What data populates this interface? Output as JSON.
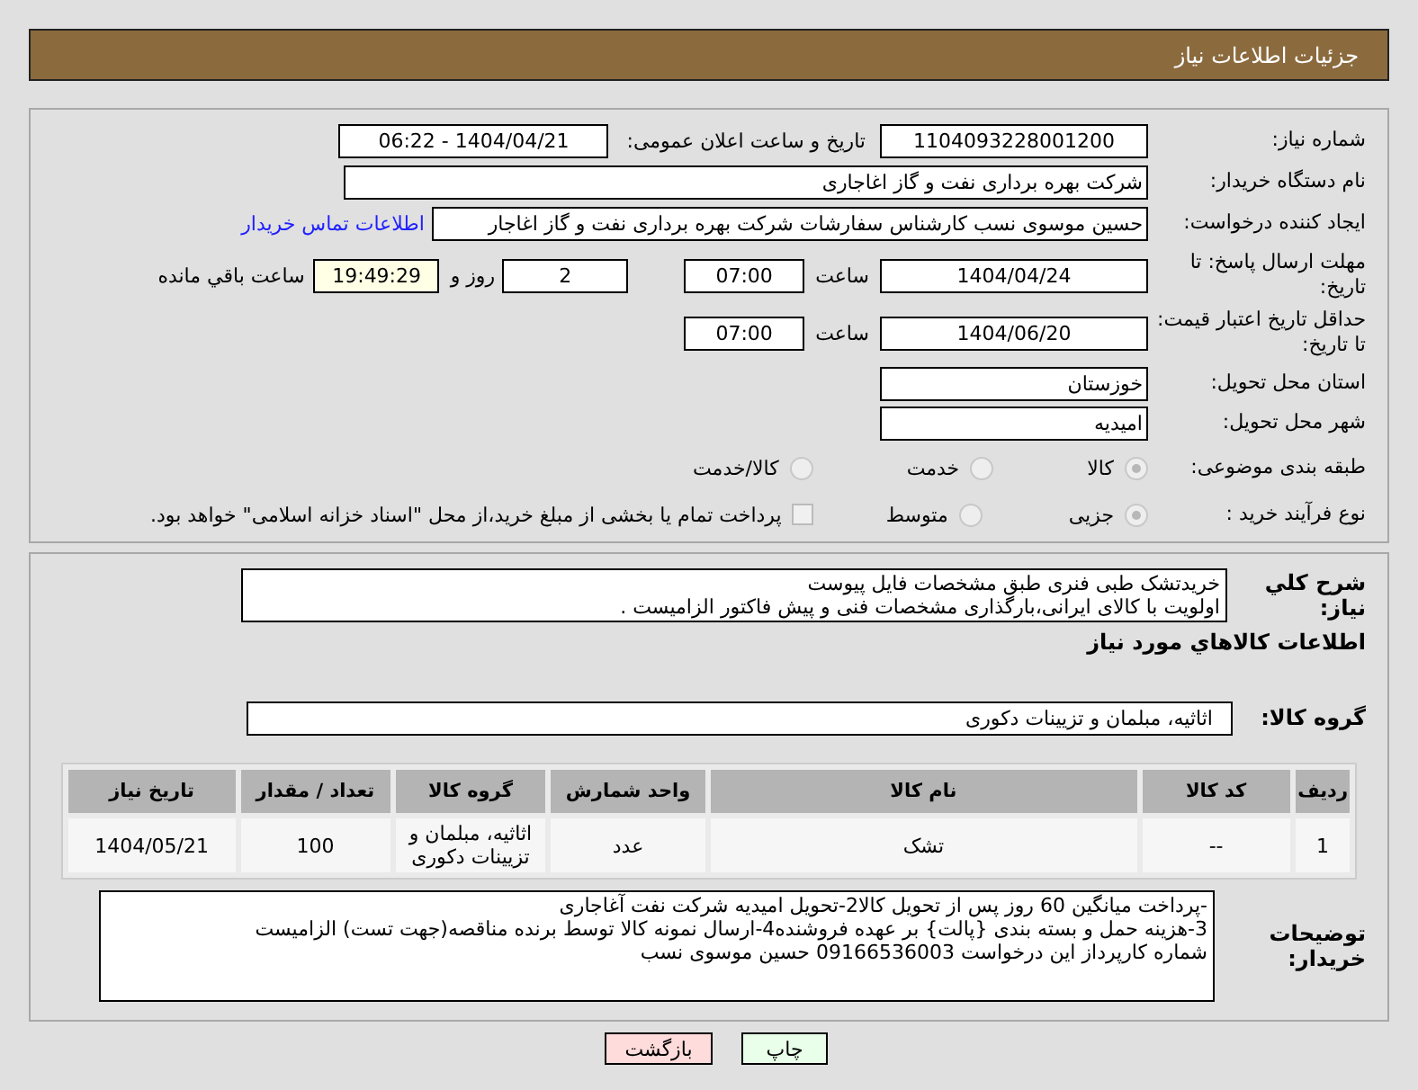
{
  "header": {
    "title": "جزئیات اطلاعات نیاز"
  },
  "need_number": {
    "label": "شماره نیاز:",
    "value": "1104093228001200"
  },
  "announce": {
    "label": "تاریخ و ساعت اعلان عمومی:",
    "value": "1404/04/21 - 06:22"
  },
  "buyer_org": {
    "label": "نام دستگاه خریدار:",
    "value": "شرکت بهره برداری نفت و گاز اغاجاری"
  },
  "creator": {
    "label": "ایجاد کننده درخواست:",
    "value": "حسین موسوی نسب کارشناس سفارشات شرکت بهره برداری نفت و گاز اغاجار",
    "contact_link": "اطلاعات تماس خریدار"
  },
  "reply_deadline": {
    "label": "مهلت ارسال پاسخ: تا تاریخ:",
    "date": "1404/04/24",
    "time_label": "ساعت",
    "time": "07:00",
    "days": "2",
    "days_label": "روز و",
    "remaining": "19:49:29",
    "remaining_label": "ساعت باقي مانده"
  },
  "price_validity": {
    "label": "حداقل تاریخ اعتبار قیمت: تا تاریخ:",
    "date": "1404/06/20",
    "time_label": "ساعت",
    "time": "07:00"
  },
  "province": {
    "label": "استان محل تحویل:",
    "value": "خوزستان"
  },
  "city": {
    "label": "شهر محل تحویل:",
    "value": "امیدیه"
  },
  "category": {
    "label": "طبقه بندی موضوعی:",
    "options": [
      {
        "label": "کالا",
        "selected": true
      },
      {
        "label": "خدمت",
        "selected": false
      },
      {
        "label": "کالا/خدمت",
        "selected": false
      }
    ]
  },
  "process": {
    "label": "نوع فرآیند خرید :",
    "options": [
      {
        "label": "جزیی",
        "selected": true
      },
      {
        "label": "متوسط",
        "selected": false
      }
    ],
    "treasury": {
      "label": "پرداخت تمام یا بخشی از مبلغ خرید،از محل \"اسناد خزانه اسلامی\" خواهد بود.",
      "checked": false
    }
  },
  "description": {
    "label": "شرح کلي نیاز:",
    "lines": [
      "خریدتشک طبی فنری  طبق مشخصات فایل پیوست",
      "اولویت با کالای ایرانی،بارگذاری مشخصات فنی و پیش فاکتور الزامیست ."
    ]
  },
  "goods_heading": "اطلاعات کالاهاي مورد نیاز",
  "goods_group": {
    "label": "گروه کالا:",
    "value": "اثاثیه، مبلمان و تزیینات دکوری"
  },
  "table": {
    "columns": [
      "ردیف",
      "کد کالا",
      "نام کالا",
      "واحد شمارش",
      "گروه کالا",
      "تعداد / مقدار",
      "تاریخ نیاز"
    ],
    "rows": [
      [
        "1",
        "--",
        "تشک",
        "عدد",
        "اثاثیه، مبلمان و تزیینات دکوری",
        "100",
        "1404/05/21"
      ]
    ]
  },
  "buyer_notes": {
    "label": "توضیحات خریدار:",
    "lines": [
      "-پرداخت میانگین 60 روز پس از تحویل کالا2-تحویل امیدیه شرکت نفت آغاجاری",
      "3-هزینه حمل  و بسته بندی {پالت} بر عهده فروشنده4-ارسال نمونه کالا توسط برنده مناقصه(جهت تست) الزامیست",
      "شماره کارپرداز این درخواست 09166536003 حسین موسوی نسب"
    ]
  },
  "buttons": [
    {
      "label": "چاپ",
      "kind": "print"
    },
    {
      "label": "بازگشت",
      "kind": "back"
    }
  ]
}
